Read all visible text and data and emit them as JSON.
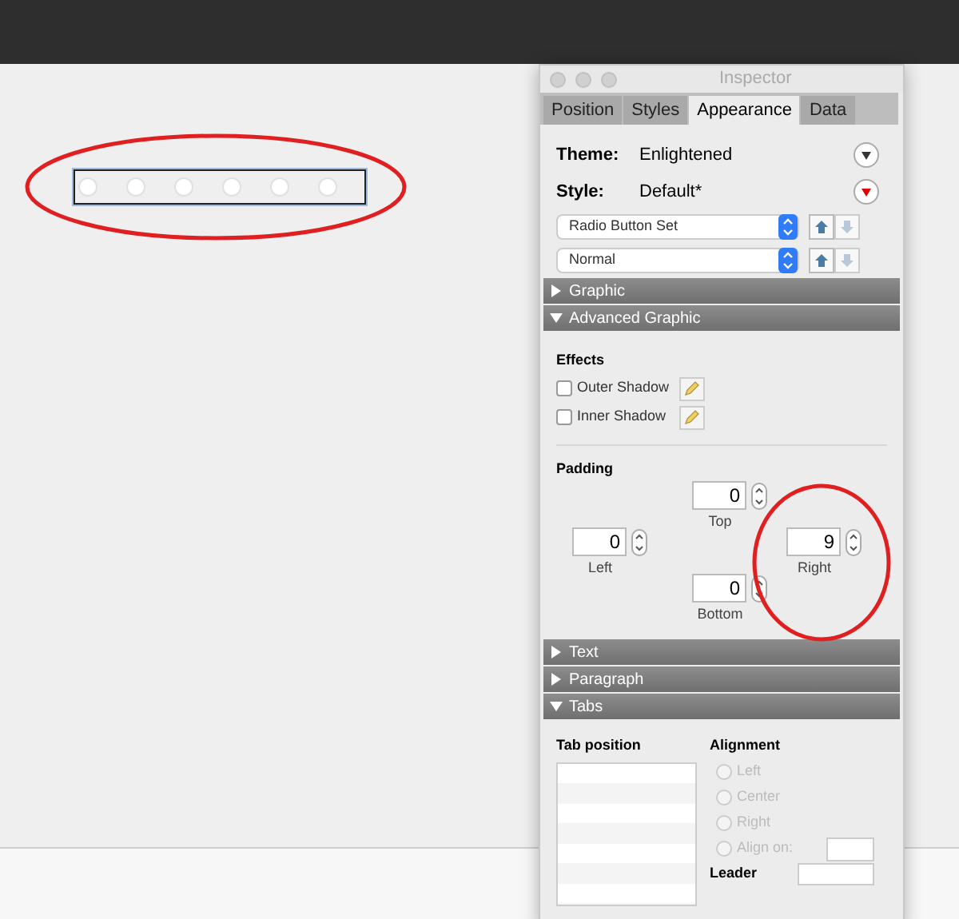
{
  "inspector": {
    "title": "Inspector",
    "tabs": [
      {
        "label": "Position",
        "selected": false
      },
      {
        "label": "Styles",
        "selected": false
      },
      {
        "label": "Appearance",
        "selected": true
      },
      {
        "label": "Data",
        "selected": false
      }
    ],
    "theme": {
      "label": "Theme:",
      "value": "Enlightened"
    },
    "style": {
      "label": "Style:",
      "value": "Default*"
    },
    "popups": [
      "Radio Button Set",
      "Normal"
    ],
    "sections": [
      {
        "kind": "graphic",
        "label": "Graphic",
        "expanded": false
      },
      {
        "kind": "advanced",
        "label": "Advanced Graphic",
        "expanded": true
      },
      {
        "kind": "text",
        "label": "Text",
        "expanded": false
      },
      {
        "kind": "paragraph",
        "label": "Paragraph",
        "expanded": false
      },
      {
        "kind": "tabs",
        "label": "Tabs",
        "expanded": true
      }
    ],
    "effects": {
      "title": "Effects",
      "items": [
        {
          "label": "Outer Shadow",
          "checked": false
        },
        {
          "label": "Inner Shadow",
          "checked": false
        }
      ]
    },
    "padding": {
      "title": "Padding",
      "top": {
        "value": "0",
        "label": "Top"
      },
      "left": {
        "value": "0",
        "label": "Left"
      },
      "right": {
        "value": "9",
        "label": "Right"
      },
      "bottom": {
        "value": "0",
        "label": "Bottom"
      }
    },
    "tab_settings": {
      "tab_position": "Tab position",
      "alignment": "Alignment",
      "options": [
        {
          "label": "Left",
          "selected": false,
          "disabled": true
        },
        {
          "label": "Center",
          "selected": false,
          "disabled": true
        },
        {
          "label": "Right",
          "selected": false,
          "disabled": true
        },
        {
          "label": "Align on:",
          "selected": false,
          "disabled": true
        }
      ],
      "leader": "Leader"
    }
  }
}
